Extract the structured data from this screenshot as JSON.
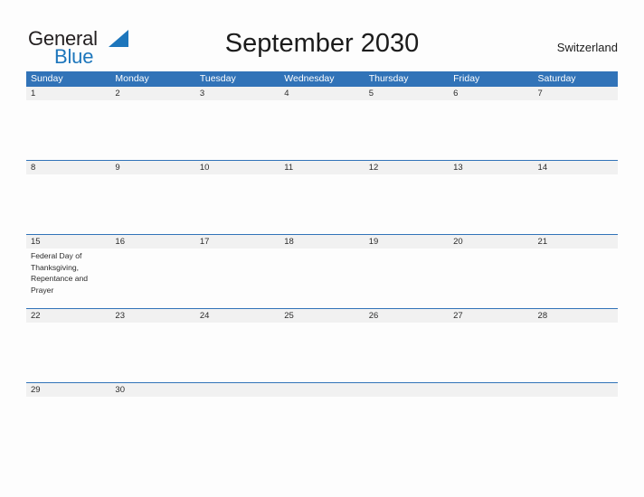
{
  "brand": {
    "name_part1": "General",
    "name_part2": "Blue",
    "logo_icon": "triangle-logo-icon",
    "color_dark": "#231f20",
    "color_blue": "#1d76bc"
  },
  "header": {
    "title": "September 2030",
    "region": "Switzerland"
  },
  "calendar": {
    "accent_color": "#3173b8",
    "date_band_color": "#f1f1f1",
    "weekdays": [
      "Sunday",
      "Monday",
      "Tuesday",
      "Wednesday",
      "Thursday",
      "Friday",
      "Saturday"
    ],
    "weeks": [
      {
        "days": [
          {
            "date": "1",
            "event": ""
          },
          {
            "date": "2",
            "event": ""
          },
          {
            "date": "3",
            "event": ""
          },
          {
            "date": "4",
            "event": ""
          },
          {
            "date": "5",
            "event": ""
          },
          {
            "date": "6",
            "event": ""
          },
          {
            "date": "7",
            "event": ""
          }
        ]
      },
      {
        "days": [
          {
            "date": "8",
            "event": ""
          },
          {
            "date": "9",
            "event": ""
          },
          {
            "date": "10",
            "event": ""
          },
          {
            "date": "11",
            "event": ""
          },
          {
            "date": "12",
            "event": ""
          },
          {
            "date": "13",
            "event": ""
          },
          {
            "date": "14",
            "event": ""
          }
        ]
      },
      {
        "days": [
          {
            "date": "15",
            "event": "Federal Day of Thanksgiving, Repentance and Prayer"
          },
          {
            "date": "16",
            "event": ""
          },
          {
            "date": "17",
            "event": ""
          },
          {
            "date": "18",
            "event": ""
          },
          {
            "date": "19",
            "event": ""
          },
          {
            "date": "20",
            "event": ""
          },
          {
            "date": "21",
            "event": ""
          }
        ]
      },
      {
        "days": [
          {
            "date": "22",
            "event": ""
          },
          {
            "date": "23",
            "event": ""
          },
          {
            "date": "24",
            "event": ""
          },
          {
            "date": "25",
            "event": ""
          },
          {
            "date": "26",
            "event": ""
          },
          {
            "date": "27",
            "event": ""
          },
          {
            "date": "28",
            "event": ""
          }
        ]
      },
      {
        "days": [
          {
            "date": "29",
            "event": ""
          },
          {
            "date": "30",
            "event": ""
          },
          {
            "date": "",
            "event": ""
          },
          {
            "date": "",
            "event": ""
          },
          {
            "date": "",
            "event": ""
          },
          {
            "date": "",
            "event": ""
          },
          {
            "date": "",
            "event": ""
          }
        ]
      }
    ]
  }
}
